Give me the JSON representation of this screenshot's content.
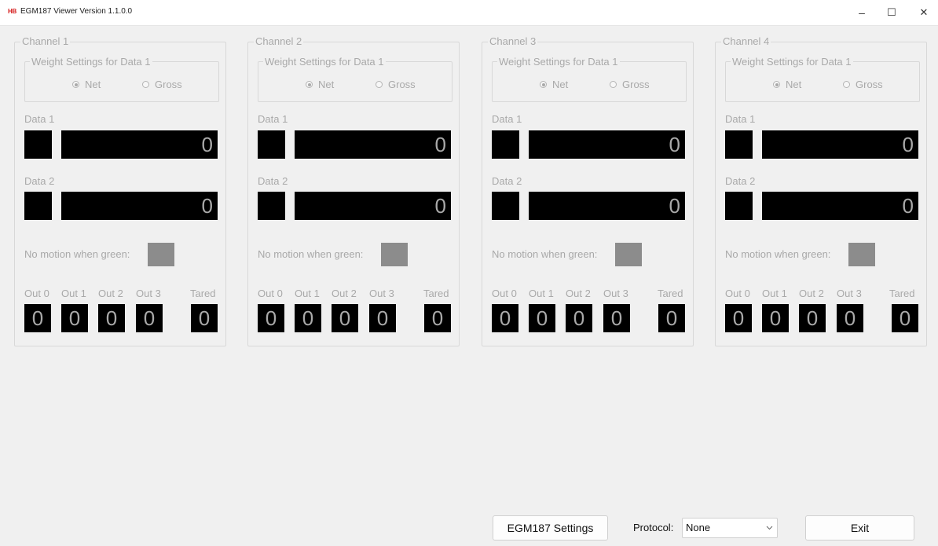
{
  "window": {
    "app_icon": "HB",
    "title": "EGM187 Viewer Version 1.1.0.0",
    "minimize": "–",
    "maximize": "☐",
    "close": "✕"
  },
  "channels": [
    {
      "title": "Channel 1",
      "weight_settings": "Weight Settings for Data 1",
      "net": "Net",
      "gross": "Gross",
      "data1_label": "Data 1",
      "data1_value": "0",
      "data2_label": "Data 2",
      "data2_value": "0",
      "motion_label": "No motion when green:",
      "outs": [
        {
          "label": "Out 0",
          "value": "0"
        },
        {
          "label": "Out 1",
          "value": "0"
        },
        {
          "label": "Out 2",
          "value": "0"
        },
        {
          "label": "Out 3",
          "value": "0"
        }
      ],
      "tared_label": "Tared",
      "tared_value": "0"
    },
    {
      "title": "Channel 2",
      "weight_settings": "Weight Settings for Data 1",
      "net": "Net",
      "gross": "Gross",
      "data1_label": "Data 1",
      "data1_value": "0",
      "data2_label": "Data 2",
      "data2_value": "0",
      "motion_label": "No motion when green:",
      "outs": [
        {
          "label": "Out 0",
          "value": "0"
        },
        {
          "label": "Out 1",
          "value": "0"
        },
        {
          "label": "Out 2",
          "value": "0"
        },
        {
          "label": "Out 3",
          "value": "0"
        }
      ],
      "tared_label": "Tared",
      "tared_value": "0"
    },
    {
      "title": "Channel 3",
      "weight_settings": "Weight Settings for Data 1",
      "net": "Net",
      "gross": "Gross",
      "data1_label": "Data 1",
      "data1_value": "0",
      "data2_label": "Data 2",
      "data2_value": "0",
      "motion_label": "No motion when green:",
      "outs": [
        {
          "label": "Out 0",
          "value": "0"
        },
        {
          "label": "Out 1",
          "value": "0"
        },
        {
          "label": "Out 2",
          "value": "0"
        },
        {
          "label": "Out 3",
          "value": "0"
        }
      ],
      "tared_label": "Tared",
      "tared_value": "0"
    },
    {
      "title": "Channel 4",
      "weight_settings": "Weight Settings for Data 1",
      "net": "Net",
      "gross": "Gross",
      "data1_label": "Data 1",
      "data1_value": "0",
      "data2_label": "Data 2",
      "data2_value": "0",
      "motion_label": "No motion when green:",
      "outs": [
        {
          "label": "Out 0",
          "value": "0"
        },
        {
          "label": "Out 1",
          "value": "0"
        },
        {
          "label": "Out 2",
          "value": "0"
        },
        {
          "label": "Out 3",
          "value": "0"
        }
      ],
      "tared_label": "Tared",
      "tared_value": "0"
    }
  ],
  "footer": {
    "settings_button": "EGM187 Settings",
    "protocol_label": "Protocol:",
    "protocol_value": "None",
    "exit_button": "Exit"
  },
  "colors": {
    "motion_indicator": "#8c8c8c",
    "display_bg": "#000000",
    "disabled_text": "#a9a9a9"
  }
}
